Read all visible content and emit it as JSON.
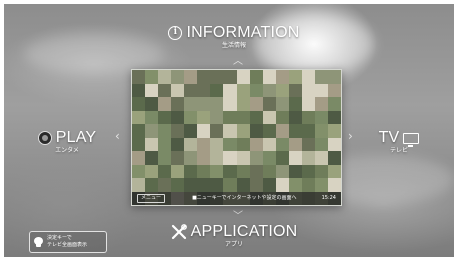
{
  "menu": {
    "top": {
      "label": "INFORMATION",
      "sub": "生活情報",
      "icon": "info-icon"
    },
    "left": {
      "label": "PLAY",
      "sub": "エンタメ",
      "icon": "play-icon"
    },
    "right": {
      "label": "TV",
      "sub": "テレビ",
      "icon": "tv-icon"
    },
    "bottom": {
      "label": "APPLICATION",
      "sub": "アプリ",
      "icon": "tools-icon"
    }
  },
  "arrows": {
    "up": "︿",
    "down": "﹀",
    "left": "‹",
    "right": "›"
  },
  "preview": {
    "menu_chip": "メニュー",
    "message": "■ニューキーでインターネットや設定の画面へ",
    "time": "15:24"
  },
  "hint": {
    "line1": "決定キーで",
    "line2": "テレビ全画面表示",
    "icon": "bulb-icon"
  },
  "colors": {
    "text": "#ffffff",
    "background_sky": "#9a9a9a",
    "preview_tint": "#6e7a62"
  }
}
